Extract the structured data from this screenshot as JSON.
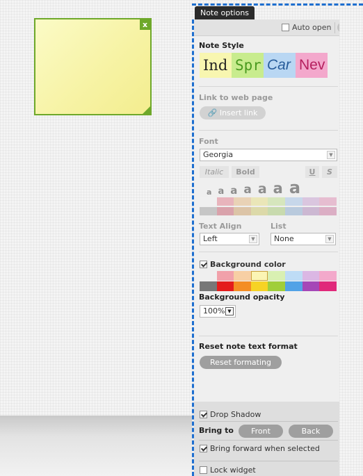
{
  "note": {
    "close_glyph": "x"
  },
  "panel": {
    "tab_label": "Note options",
    "auto_open_label": "Auto open",
    "auto_open_checked": false
  },
  "note_style": {
    "title": "Note Style",
    "options": [
      "Ind",
      "Spr",
      "Car",
      "Nev"
    ]
  },
  "link": {
    "title": "Link to web page",
    "insert_label": "Insert link"
  },
  "font": {
    "title": "Font",
    "selected": "Georgia",
    "italic_label": "Italic",
    "bold_label": "Bold",
    "underline_label": "U",
    "strike_label": "S",
    "size_glyph": "a",
    "sizes": 7,
    "colors_row1": [
      "#f0f0f0",
      "#e8b4bc",
      "#e9d2b6",
      "#eae6b8",
      "#d6e6bd",
      "#c7d7ea",
      "#dac6df",
      "#e6bdd0"
    ],
    "colors_row2": [
      "#c6c6c6",
      "#d9a2ab",
      "#dcc4a7",
      "#dcd9a9",
      "#c8daae",
      "#b9cadd",
      "#ccb8d2",
      "#dbaec4"
    ]
  },
  "text_align": {
    "title": "Text Align",
    "selected": "Left"
  },
  "list": {
    "title": "List",
    "selected": "None"
  },
  "background": {
    "title": "Background color",
    "checked": true,
    "row1": [
      "#efefef",
      "#f1a1aa",
      "#f7cfa4",
      "#fbf5b4",
      "#d9f0b2",
      "#bedcf6",
      "#dbb7e4",
      "#f3a9cb"
    ],
    "row2": [
      "#777777",
      "#e41c1c",
      "#f48d24",
      "#f6d324",
      "#a0ce3a",
      "#52a2e6",
      "#a547b7",
      "#e0287a"
    ],
    "selected_index": 3
  },
  "opacity": {
    "title": "Background opacity",
    "selected": "100%"
  },
  "reset": {
    "title": "Reset note text format",
    "button_label": "Reset formating"
  },
  "bottom": {
    "drop_shadow_label": "Drop Shadow",
    "drop_shadow_checked": true,
    "bring_to_label": "Bring to",
    "front_label": "Front",
    "back_label": "Back",
    "bring_forward_label": "Bring forward when selected",
    "bring_forward_checked": true,
    "lock_label": "Lock widget",
    "lock_checked": false
  }
}
